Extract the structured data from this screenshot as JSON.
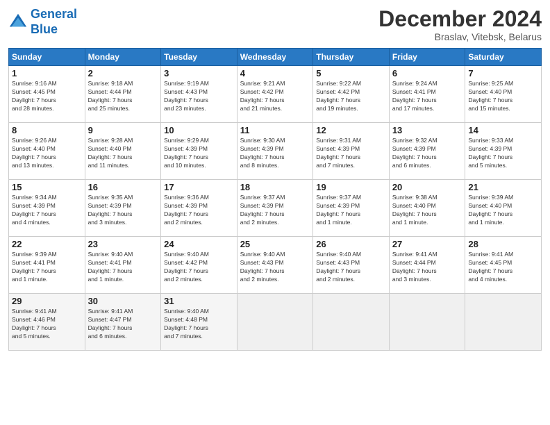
{
  "header": {
    "logo_line1": "General",
    "logo_line2": "Blue",
    "month": "December 2024",
    "location": "Braslav, Vitebsk, Belarus"
  },
  "weekdays": [
    "Sunday",
    "Monday",
    "Tuesday",
    "Wednesday",
    "Thursday",
    "Friday",
    "Saturday"
  ],
  "weeks": [
    [
      {
        "day": "1",
        "info": "Sunrise: 9:16 AM\nSunset: 4:45 PM\nDaylight: 7 hours\nand 28 minutes."
      },
      {
        "day": "2",
        "info": "Sunrise: 9:18 AM\nSunset: 4:44 PM\nDaylight: 7 hours\nand 25 minutes."
      },
      {
        "day": "3",
        "info": "Sunrise: 9:19 AM\nSunset: 4:43 PM\nDaylight: 7 hours\nand 23 minutes."
      },
      {
        "day": "4",
        "info": "Sunrise: 9:21 AM\nSunset: 4:42 PM\nDaylight: 7 hours\nand 21 minutes."
      },
      {
        "day": "5",
        "info": "Sunrise: 9:22 AM\nSunset: 4:42 PM\nDaylight: 7 hours\nand 19 minutes."
      },
      {
        "day": "6",
        "info": "Sunrise: 9:24 AM\nSunset: 4:41 PM\nDaylight: 7 hours\nand 17 minutes."
      },
      {
        "day": "7",
        "info": "Sunrise: 9:25 AM\nSunset: 4:40 PM\nDaylight: 7 hours\nand 15 minutes."
      }
    ],
    [
      {
        "day": "8",
        "info": "Sunrise: 9:26 AM\nSunset: 4:40 PM\nDaylight: 7 hours\nand 13 minutes."
      },
      {
        "day": "9",
        "info": "Sunrise: 9:28 AM\nSunset: 4:40 PM\nDaylight: 7 hours\nand 11 minutes."
      },
      {
        "day": "10",
        "info": "Sunrise: 9:29 AM\nSunset: 4:39 PM\nDaylight: 7 hours\nand 10 minutes."
      },
      {
        "day": "11",
        "info": "Sunrise: 9:30 AM\nSunset: 4:39 PM\nDaylight: 7 hours\nand 8 minutes."
      },
      {
        "day": "12",
        "info": "Sunrise: 9:31 AM\nSunset: 4:39 PM\nDaylight: 7 hours\nand 7 minutes."
      },
      {
        "day": "13",
        "info": "Sunrise: 9:32 AM\nSunset: 4:39 PM\nDaylight: 7 hours\nand 6 minutes."
      },
      {
        "day": "14",
        "info": "Sunrise: 9:33 AM\nSunset: 4:39 PM\nDaylight: 7 hours\nand 5 minutes."
      }
    ],
    [
      {
        "day": "15",
        "info": "Sunrise: 9:34 AM\nSunset: 4:39 PM\nDaylight: 7 hours\nand 4 minutes."
      },
      {
        "day": "16",
        "info": "Sunrise: 9:35 AM\nSunset: 4:39 PM\nDaylight: 7 hours\nand 3 minutes."
      },
      {
        "day": "17",
        "info": "Sunrise: 9:36 AM\nSunset: 4:39 PM\nDaylight: 7 hours\nand 2 minutes."
      },
      {
        "day": "18",
        "info": "Sunrise: 9:37 AM\nSunset: 4:39 PM\nDaylight: 7 hours\nand 2 minutes."
      },
      {
        "day": "19",
        "info": "Sunrise: 9:37 AM\nSunset: 4:39 PM\nDaylight: 7 hours\nand 1 minute."
      },
      {
        "day": "20",
        "info": "Sunrise: 9:38 AM\nSunset: 4:40 PM\nDaylight: 7 hours\nand 1 minute."
      },
      {
        "day": "21",
        "info": "Sunrise: 9:39 AM\nSunset: 4:40 PM\nDaylight: 7 hours\nand 1 minute."
      }
    ],
    [
      {
        "day": "22",
        "info": "Sunrise: 9:39 AM\nSunset: 4:41 PM\nDaylight: 7 hours\nand 1 minute."
      },
      {
        "day": "23",
        "info": "Sunrise: 9:40 AM\nSunset: 4:41 PM\nDaylight: 7 hours\nand 1 minute."
      },
      {
        "day": "24",
        "info": "Sunrise: 9:40 AM\nSunset: 4:42 PM\nDaylight: 7 hours\nand 2 minutes."
      },
      {
        "day": "25",
        "info": "Sunrise: 9:40 AM\nSunset: 4:43 PM\nDaylight: 7 hours\nand 2 minutes."
      },
      {
        "day": "26",
        "info": "Sunrise: 9:40 AM\nSunset: 4:43 PM\nDaylight: 7 hours\nand 2 minutes."
      },
      {
        "day": "27",
        "info": "Sunrise: 9:41 AM\nSunset: 4:44 PM\nDaylight: 7 hours\nand 3 minutes."
      },
      {
        "day": "28",
        "info": "Sunrise: 9:41 AM\nSunset: 4:45 PM\nDaylight: 7 hours\nand 4 minutes."
      }
    ],
    [
      {
        "day": "29",
        "info": "Sunrise: 9:41 AM\nSunset: 4:46 PM\nDaylight: 7 hours\nand 5 minutes."
      },
      {
        "day": "30",
        "info": "Sunrise: 9:41 AM\nSunset: 4:47 PM\nDaylight: 7 hours\nand 6 minutes."
      },
      {
        "day": "31",
        "info": "Sunrise: 9:40 AM\nSunset: 4:48 PM\nDaylight: 7 hours\nand 7 minutes."
      },
      {
        "day": "",
        "info": ""
      },
      {
        "day": "",
        "info": ""
      },
      {
        "day": "",
        "info": ""
      },
      {
        "day": "",
        "info": ""
      }
    ]
  ]
}
